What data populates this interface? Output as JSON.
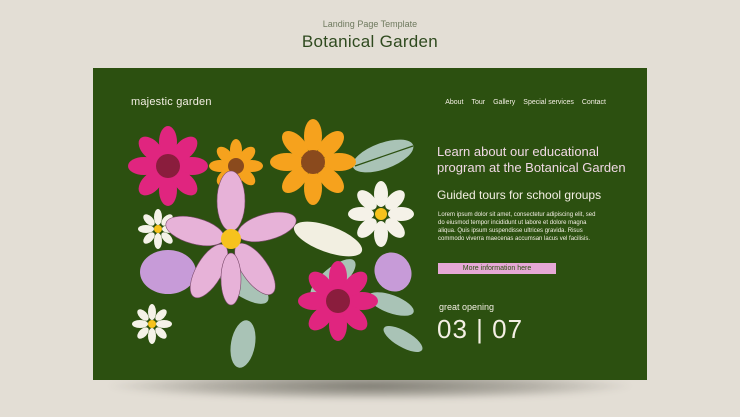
{
  "caption": {
    "subtitle": "Landing Page Template",
    "title": "Botanical Garden"
  },
  "page": {
    "brand": "majestic garden",
    "nav": [
      "About",
      "Tour",
      "Gallery",
      "Special services",
      "Contact"
    ],
    "headline": "Learn about our educational program at the Botanical Garden",
    "subheadline": "Guided tours for school groups",
    "body": "Lorem ipsum dolor sit amet, consectetur adipiscing elit, sed do eiusmod tempor incididunt ut labore et dolore magna aliqua. Quis ipsum suspendisse ultrices gravida. Risus commodo viverra maecenas accumsan lacus vel facilisis.",
    "button": "More information here",
    "opening_label": "great opening",
    "opening_date": "03 | 07"
  },
  "colors": {
    "background": "#e3ded5",
    "card": "#2c5010",
    "accent_pink": "#e6a8d6",
    "text_light": "#f4efe4"
  },
  "illustration": {
    "description_icons": [
      "magenta-daisy-icon",
      "orange-daisy-icon",
      "pink-cosmos-icon",
      "white-daisy-icon",
      "leaf-icon"
    ]
  }
}
